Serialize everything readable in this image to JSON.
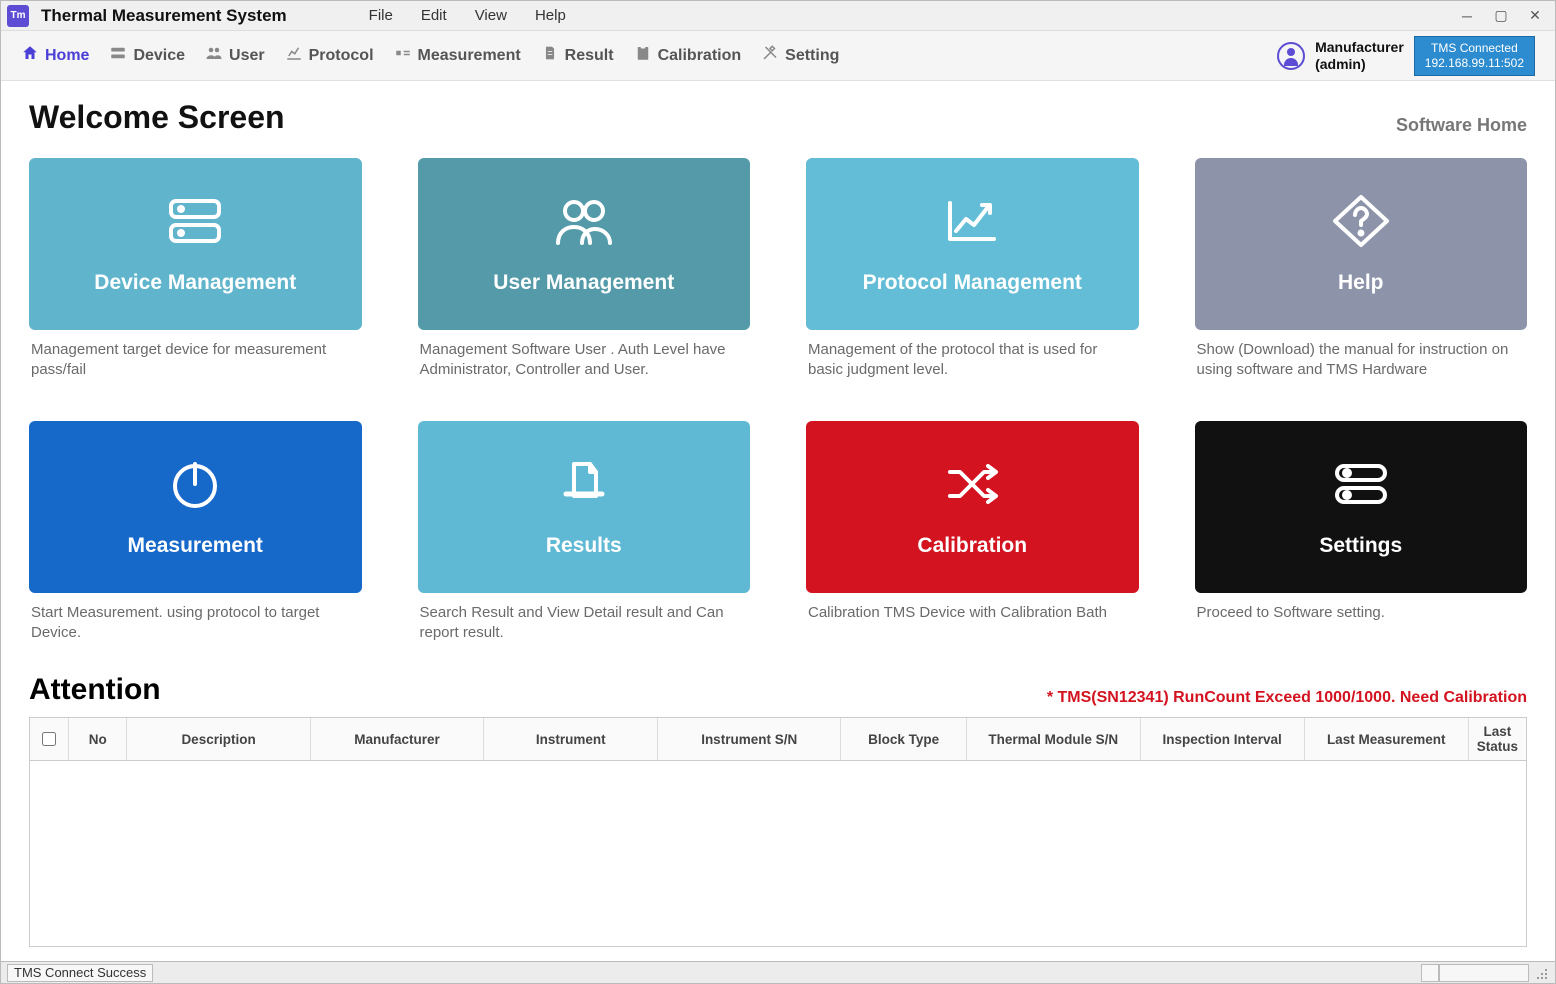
{
  "app": {
    "title": "Thermal Measurement System",
    "icon_text": "Tm"
  },
  "menubar": {
    "file": "File",
    "edit": "Edit",
    "view": "View",
    "help": "Help"
  },
  "nav": {
    "home": "Home",
    "device": "Device",
    "user": "User",
    "protocol": "Protocol",
    "measurement": "Measurement",
    "result": "Result",
    "calibration": "Calibration",
    "setting": "Setting"
  },
  "user_block": {
    "line1": "Manufacturer",
    "line2": "(admin)",
    "conn_title": "TMS Connected",
    "conn_addr": "192.168.99.11:502"
  },
  "welcome": {
    "heading": "Welcome Screen",
    "software_home": "Software Home"
  },
  "cards": {
    "device": {
      "title": "Device Management",
      "desc": "Management target device for measurement pass/fail"
    },
    "user": {
      "title": "User Management",
      "desc": "Management Software User . Auth Level have Administrator, Controller and User."
    },
    "protocol": {
      "title": "Protocol Management",
      "desc": "Management of the protocol that is used for basic judgment level."
    },
    "help": {
      "title": "Help",
      "desc": "Show (Download) the manual for instruction on using software and TMS Hardware"
    },
    "measure": {
      "title": "Measurement",
      "desc": "Start Measurement. using protocol to target Device."
    },
    "results": {
      "title": "Results",
      "desc": "Search Result and View Detail result and Can report result."
    },
    "calib": {
      "title": "Calibration",
      "desc": "Calibration TMS Device with Calibration Bath"
    },
    "settings": {
      "title": "Settings",
      "desc": "Proceed to Software setting."
    }
  },
  "attention": {
    "heading": "Attention",
    "warning": "* TMS(SN12341) RunCount Exceed 1000/1000. Need Calibration",
    "columns": {
      "no": "No",
      "description": "Description",
      "manufacturer": "Manufacturer",
      "instrument": "Instrument",
      "instrument_sn": "Instrument S/N",
      "block_type": "Block Type",
      "thermal_module_sn": "Thermal Module S/N",
      "inspection_interval": "Inspection Interval",
      "last_measurement": "Last Measurement",
      "last_status": "Last Status"
    }
  },
  "statusbar": {
    "message": "TMS Connect Success"
  }
}
